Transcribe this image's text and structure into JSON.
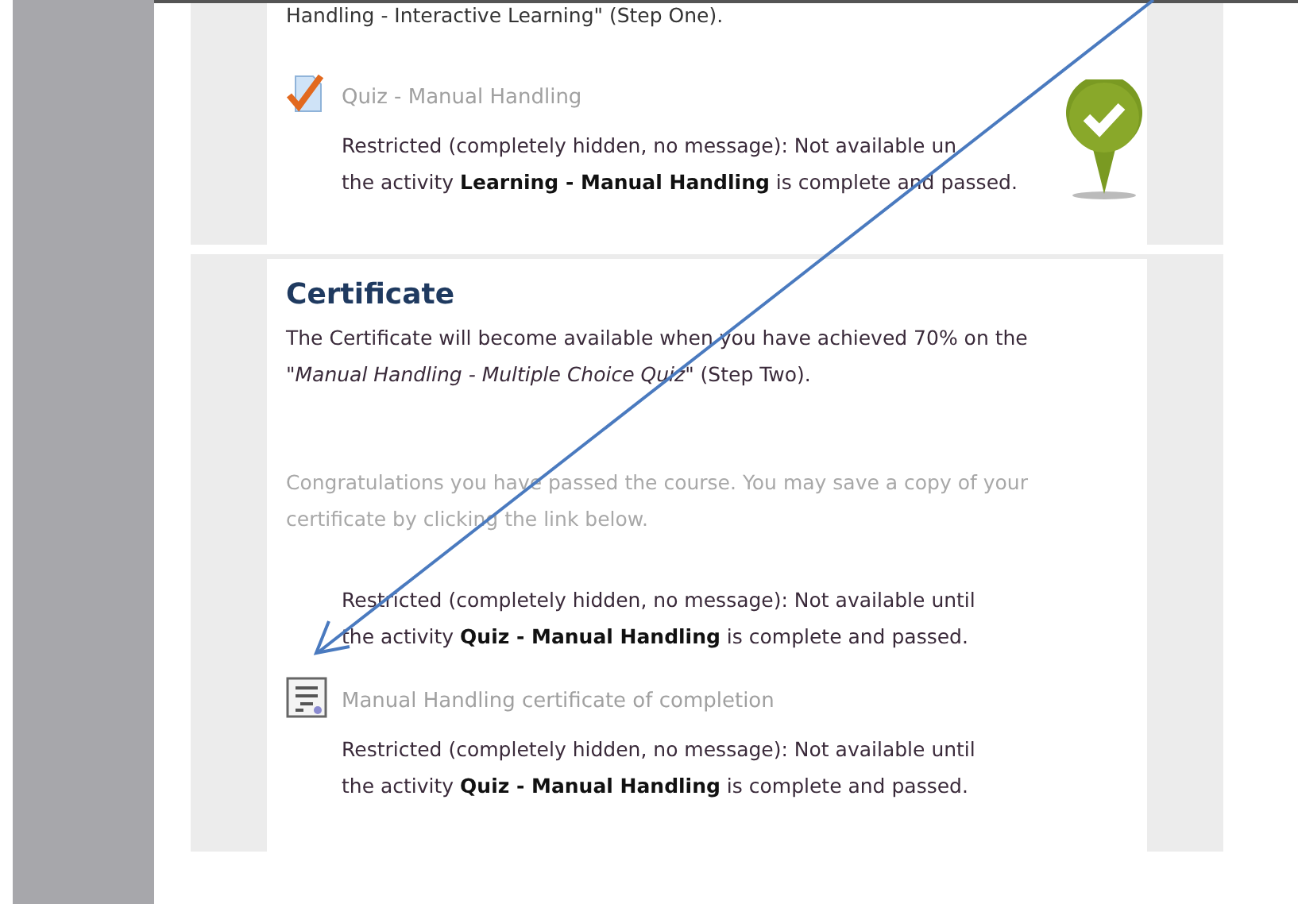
{
  "sections": [
    {
      "intro": "Handling - Interactive Learning\" (Step One).",
      "activities": [
        {
          "kind": "quiz",
          "title": "Quiz - Manual Handling",
          "restriction": [
            "Restricted (completely hidden, no message): Not available un",
            "the activity **Learning - Manual Handling** is complete and passed."
          ],
          "badge": true
        }
      ]
    },
    {
      "heading": "Certificate",
      "description": "The Certificate will become available when you have achieved 70% on the \"*Manual Handling - Multiple Choice Quiz*\" (Step Two).",
      "hidden_text": "Congratulations you have passed the course. You may save a copy of your certificate by clicking the link below.",
      "restriction": [
        "Restricted (completely hidden, no message): Not available until",
        "the activity **Quiz - Manual Handling** is complete and passed."
      ],
      "activities": [
        {
          "kind": "certificate",
          "title": "Manual Handling certificate of completion",
          "restriction": [
            "Restricted (completely hidden, no message): Not available until",
            "the activity **Quiz - Manual Handling** is complete and passed."
          ],
          "badge": false
        }
      ]
    }
  ]
}
